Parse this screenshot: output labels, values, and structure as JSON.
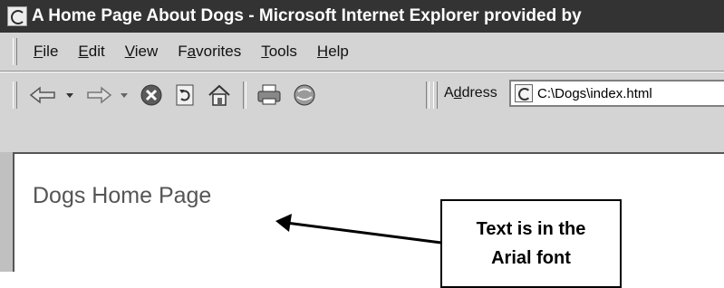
{
  "window": {
    "title": "A Home Page About Dogs - Microsoft Internet Explorer provided by"
  },
  "menu": [
    {
      "accel": "F",
      "rest": "ile"
    },
    {
      "accel": "E",
      "rest": "dit"
    },
    {
      "accel": "V",
      "rest": "iew"
    },
    {
      "pre": "F",
      "accel": "a",
      "rest": "vorites"
    },
    {
      "accel": "T",
      "rest": "ools"
    },
    {
      "accel": "H",
      "rest": "elp"
    }
  ],
  "toolbar": {
    "address_pre": "A",
    "address_accel": "d",
    "address_rest": "dress",
    "address_value": "C:\\Dogs\\index.html",
    "icons": [
      "back-icon",
      "back-dropdown-icon",
      "forward-icon",
      "forward-dropdown-icon",
      "stop-icon",
      "refresh-icon",
      "home-icon",
      "print-icon",
      "media-icon"
    ]
  },
  "page": {
    "heading": "Dogs Home Page"
  },
  "annotation": {
    "line1": "Text is in the",
    "line2": "Arial font"
  }
}
